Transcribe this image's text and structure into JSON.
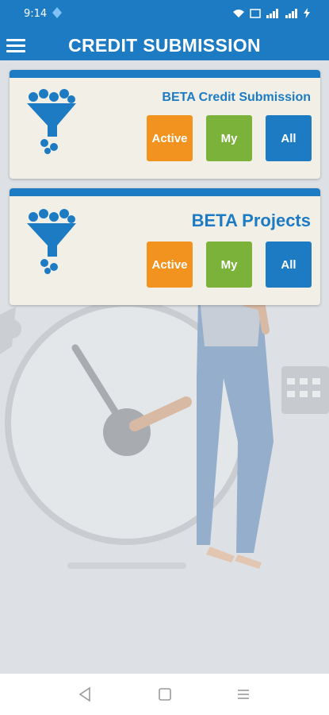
{
  "status_bar": {
    "time": "9:14"
  },
  "app_bar": {
    "title": "CREDIT SUBMISSION"
  },
  "cards": [
    {
      "title": "BETA Credit Submission",
      "buttons": [
        "Active",
        "My",
        "All"
      ]
    },
    {
      "title": "BETA Projects",
      "buttons": [
        "Active",
        "My",
        "All"
      ]
    }
  ],
  "colors": {
    "primary": "#1d7bc4",
    "active": "#f1931e",
    "my": "#7bb23a",
    "card_bg": "#f2f0e6"
  }
}
